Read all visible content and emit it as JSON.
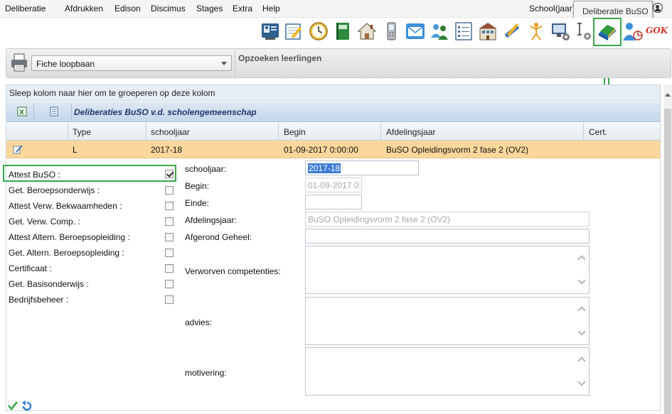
{
  "menu": {
    "items": [
      "Deliberatie",
      "Afdrukken",
      "Edison",
      "Discimus",
      "Stages",
      "Extra",
      "Help"
    ],
    "right_text": "School(jaar)"
  },
  "tooltip": {
    "text": "Deliberatie BuSO"
  },
  "toolbar": {
    "icons": [
      "id-card-icon",
      "notepad-pencil-icon",
      "clock-icon",
      "green-book-icon",
      "house-icon",
      "mobile-phone-icon",
      "mail-envelope-icon",
      "users-group-icon",
      "checklist-icon",
      "building-icon",
      "tools-icon",
      "stick-figure-icon",
      "computer-gear-icon",
      "text-cursor-gear-icon",
      "deliberatie-book-icon",
      "user-chart-icon",
      "gok-logo"
    ],
    "gok_text": "GOK"
  },
  "search_strip": {
    "select_value": "Fiche loopbaan",
    "title": "Opzoeken leerlingen"
  },
  "grid": {
    "group_hint": "Sleep kolom naar hier om te groeperen op deze kolom",
    "title": "Deliberaties BuSO v.d. scholengemeenschap",
    "columns": [
      "Type",
      "schooljaar",
      "Begin",
      "Afdelingsjaar",
      "Cert."
    ],
    "rows": [
      {
        "type": "L",
        "schooljaar": "2017-18",
        "begin": "01-09-2017 0:00:00",
        "afdelingsjaar": "BuSO Opleidingsvorm 2 fase 2 (OV2)",
        "cert": ""
      }
    ]
  },
  "checkboxes": [
    {
      "label": "Attest BuSO :",
      "checked": true
    },
    {
      "label": "Get. Beroepsonderwijs :",
      "checked": false
    },
    {
      "label": "Attest Verw. Bekwaamheden :",
      "checked": false
    },
    {
      "label": "Get. Verw. Comp. :",
      "checked": false
    },
    {
      "label": "Attest Altern. Beroepsopleiding :",
      "checked": false
    },
    {
      "label": "Get. Altern. Beroepsopleiding :",
      "checked": false
    },
    {
      "label": "Certificaat :",
      "checked": false
    },
    {
      "label": "Get. Basisonderwijs :",
      "checked": false
    },
    {
      "label": "Bedrijfsbeheer :",
      "checked": false
    }
  ],
  "form": {
    "schooljaar_label": "schooljaar:",
    "schooljaar_value": "2017-18",
    "begin_label": "Begin:",
    "begin_value": "01-09-2017 0:",
    "einde_label": "Einde:",
    "einde_value": "",
    "afdelingsjaar_label": "Afdelingsjaar:",
    "afdelingsjaar_value": "BuSO Opleidingsvorm 2 fase 2 (OV2)",
    "afgerond_label": "Afgerond Geheel:",
    "afgerond_value": "",
    "competenties_label": "Verworven competenties:",
    "advies_label": "advies:",
    "motivering_label": "motivering:"
  },
  "colors": {
    "selected_row": "#fcd79c",
    "highlight_green": "#3aa54a",
    "grid_title": "#1f3770"
  }
}
